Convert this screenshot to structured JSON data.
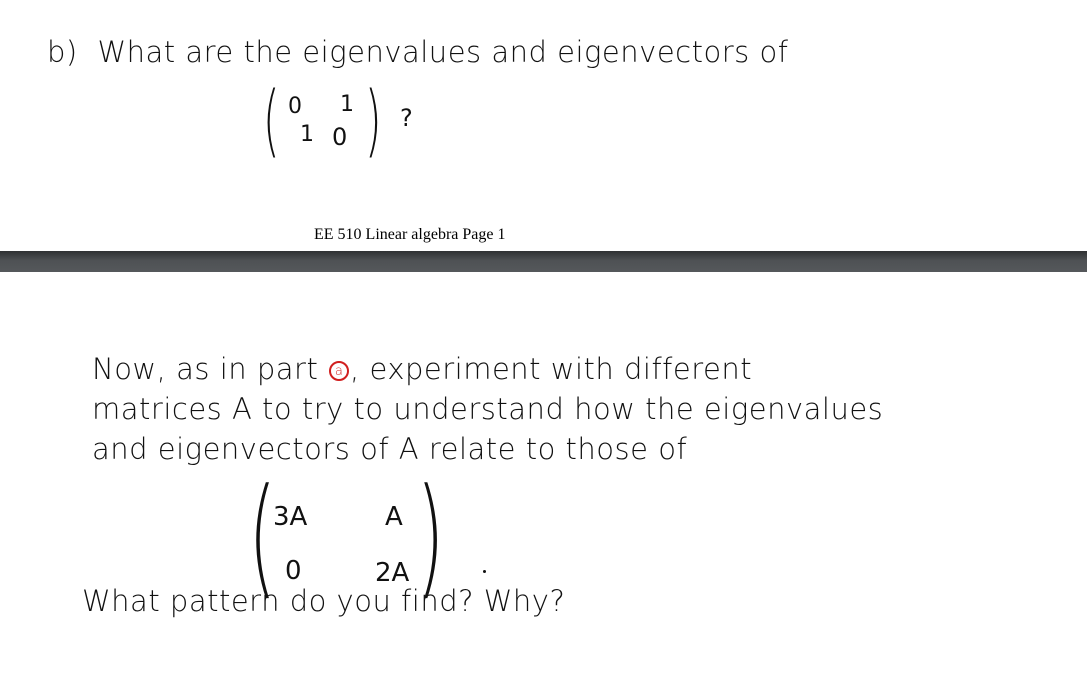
{
  "page1": {
    "question_label": "b)",
    "question_text": "What are the eigenvalues and eigenvectors of",
    "matrix": {
      "row1": [
        "0",
        "1"
      ],
      "row2": [
        "1",
        "0"
      ]
    },
    "question_mark": "?",
    "footer": "EE 510 Linear algebra Page 1"
  },
  "page2": {
    "line1_before": "Now, as in part",
    "part_ref": "a",
    "line1_after": ", experiment with different",
    "line2": "matrices A to try to understand how the eigenvalues",
    "line3": "and eigenvectors of A relate to those of",
    "matrix": {
      "row1": [
        "3A",
        "A"
      ],
      "row2": [
        "0",
        "2A"
      ]
    },
    "line4": "What pattern do you find?  Why?"
  },
  "colors": {
    "ink": "#111111",
    "annotation": "#d11f1f",
    "separator": "#4e5154"
  }
}
